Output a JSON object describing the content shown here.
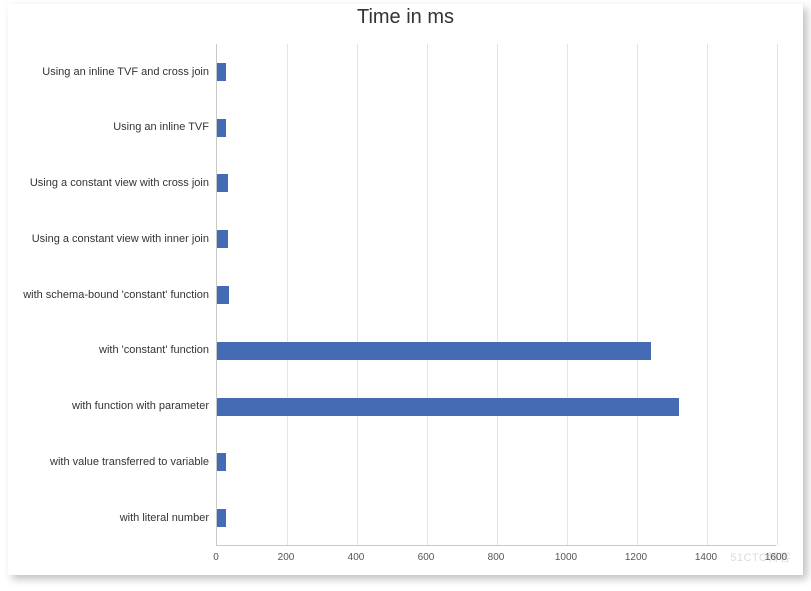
{
  "chart_data": {
    "type": "bar",
    "orientation": "horizontal",
    "title": "Time in ms",
    "xlabel": "",
    "ylabel": "",
    "xlim": [
      0,
      1600
    ],
    "x_ticks": [
      0,
      200,
      400,
      600,
      800,
      1000,
      1200,
      1400,
      1600
    ],
    "categories": [
      "Using an inline TVF and cross join",
      "Using an inline TVF",
      "Using a constant view with cross join",
      "Using a constant view with inner join",
      "with schema-bound 'constant' function",
      "with 'constant' function",
      "with function with parameter",
      "with value transferred to variable",
      "with literal number"
    ],
    "values": [
      25,
      25,
      30,
      30,
      35,
      1240,
      1320,
      25,
      25
    ],
    "bar_color": "#446bb3",
    "grid": true,
    "legend": false
  },
  "watermark": "51CTO博客"
}
